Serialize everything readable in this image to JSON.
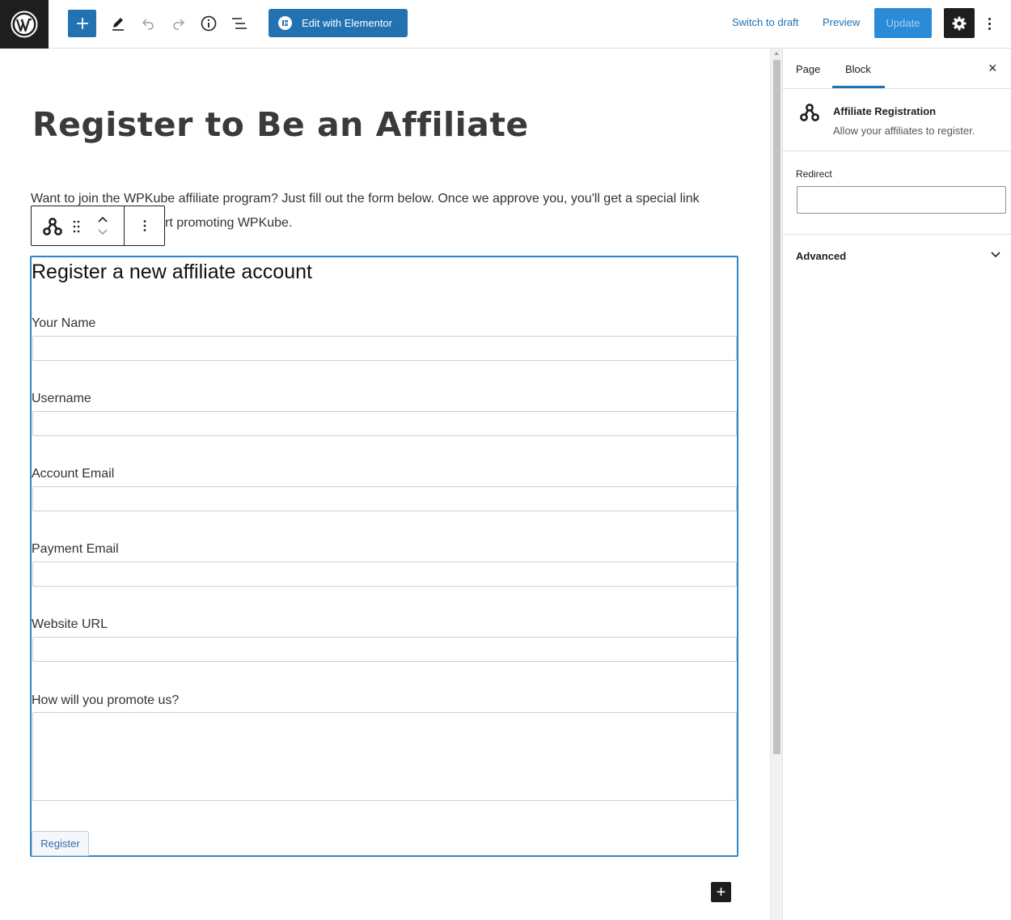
{
  "topbar": {
    "elementor_label": "Edit with Elementor",
    "switch_draft_label": "Switch to draft",
    "preview_label": "Preview",
    "update_label": "Update"
  },
  "content": {
    "title": "Register to Be an Affiliate",
    "intro_line1": "Want to join the WPKube affiliate program? Just fill out the form below. Once we approve you, you'll get a special link",
    "intro_line2_visible": "rt promoting WPKube."
  },
  "form": {
    "heading": "Register a new affiliate account",
    "fields": [
      {
        "label": "Your Name"
      },
      {
        "label": "Username"
      },
      {
        "label": "Account Email"
      },
      {
        "label": "Payment Email"
      },
      {
        "label": "Website URL"
      },
      {
        "label": "How will you promote us?"
      }
    ],
    "submit_label": "Register"
  },
  "inserter_glyph": "+",
  "sidebar": {
    "tabs": [
      {
        "label": "Page"
      },
      {
        "label": "Block"
      }
    ],
    "active_tab": "Block",
    "close_glyph": "×",
    "block_title": "Affiliate Registration",
    "block_description": "Allow your affiliates to register.",
    "redirect_label": "Redirect",
    "redirect_value": "",
    "advanced_label": "Advanced"
  },
  "colors": {
    "accent": "#2271b1",
    "selected_block_border": "#2e87c4",
    "dark": "#1e1e1e"
  },
  "icons": [
    "wordpress-logo-icon",
    "plus-icon",
    "pencil-icon",
    "undo-icon",
    "redo-icon",
    "info-icon",
    "list-view-icon",
    "elementor-icon",
    "gear-icon",
    "more-vertical-icon",
    "affiliate-block-icon",
    "drag-handle-icon",
    "chevron-up-icon",
    "chevron-down-icon",
    "close-icon"
  ]
}
